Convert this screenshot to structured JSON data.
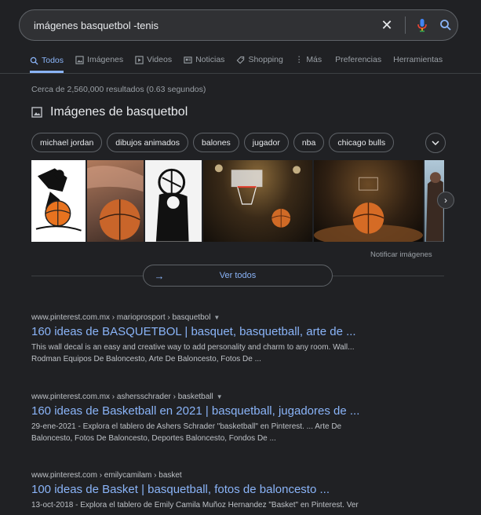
{
  "search": {
    "query": "imágenes basquetbol -tenis"
  },
  "tabs": [
    {
      "label": "Todos",
      "icon": "search-icon",
      "active": true
    },
    {
      "label": "Imágenes",
      "icon": "image-icon"
    },
    {
      "label": "Videos",
      "icon": "video-icon"
    },
    {
      "label": "Noticias",
      "icon": "news-icon"
    },
    {
      "label": "Shopping",
      "icon": "tag-icon"
    },
    {
      "label": "Más",
      "icon": "more-vert-icon"
    },
    {
      "label": "Preferencias"
    },
    {
      "label": "Herramientas"
    }
  ],
  "stats": "Cerca de 2,560,000 resultados (0.63 segundos)",
  "images_section": {
    "title": "Imágenes de basquetbol",
    "chips": [
      "michael jordan",
      "dibujos animados",
      "balones",
      "jugador",
      "nba",
      "chicago bulls"
    ],
    "notify": "Notificar imágenes",
    "see_all": "Ver todos"
  },
  "results": [
    {
      "url": "www.pinterest.com.mx › marioprosport › basquetbol",
      "title": "160 ideas de BASQUETBOL | basquet, basquetball, arte de ...",
      "snippet1": "This wall decal is an easy and creative way to add personality and charm to any room. Wall...",
      "snippet2": "Rodman Equipos De Baloncesto, Arte De Baloncesto, Fotos De ..."
    },
    {
      "url": "www.pinterest.com.mx › ashersschrader › basketball",
      "title": "160 ideas de Basketball en 2021 | basquetball, jugadores de ...",
      "snippet1": "29-ene-2021 - Explora el tablero de Ashers Schrader \"basketball\" en Pinterest. ... Arte De",
      "snippet2": "Baloncesto, Fotos De Baloncesto, Deportes Baloncesto, Fondos De ..."
    },
    {
      "url": "www.pinterest.com › emilycamilam › basket",
      "title": "100 ideas de Basket | basquetball, fotos de baloncesto ...",
      "snippet1": "13-oct-2018 - Explora el tablero de Emily Camila Muñoz Hernandez \"Basket\" en Pinterest. Ver",
      "snippet2": ""
    }
  ],
  "colors": {
    "background": "#202124",
    "link": "#8ab4f8",
    "text": "#bdc1c6",
    "border": "#5f6368"
  }
}
